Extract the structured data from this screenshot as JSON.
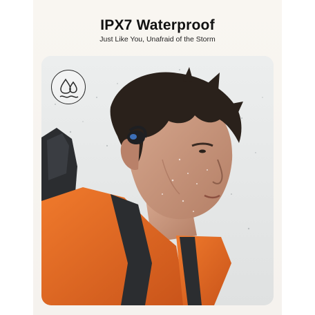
{
  "headline": "IPX7 Waterproof",
  "subline": "Just Like You, Unafraid of the Storm",
  "badge": {
    "icon": "water-drops-icon"
  },
  "photo": {
    "subject": "man-in-rain-with-earbud"
  },
  "colors": {
    "jacket": "#e0661f",
    "backpack": "#2b2d30",
    "sky": "#e4e6e6",
    "hair": "#2a211b",
    "skin": "#c4937a"
  }
}
